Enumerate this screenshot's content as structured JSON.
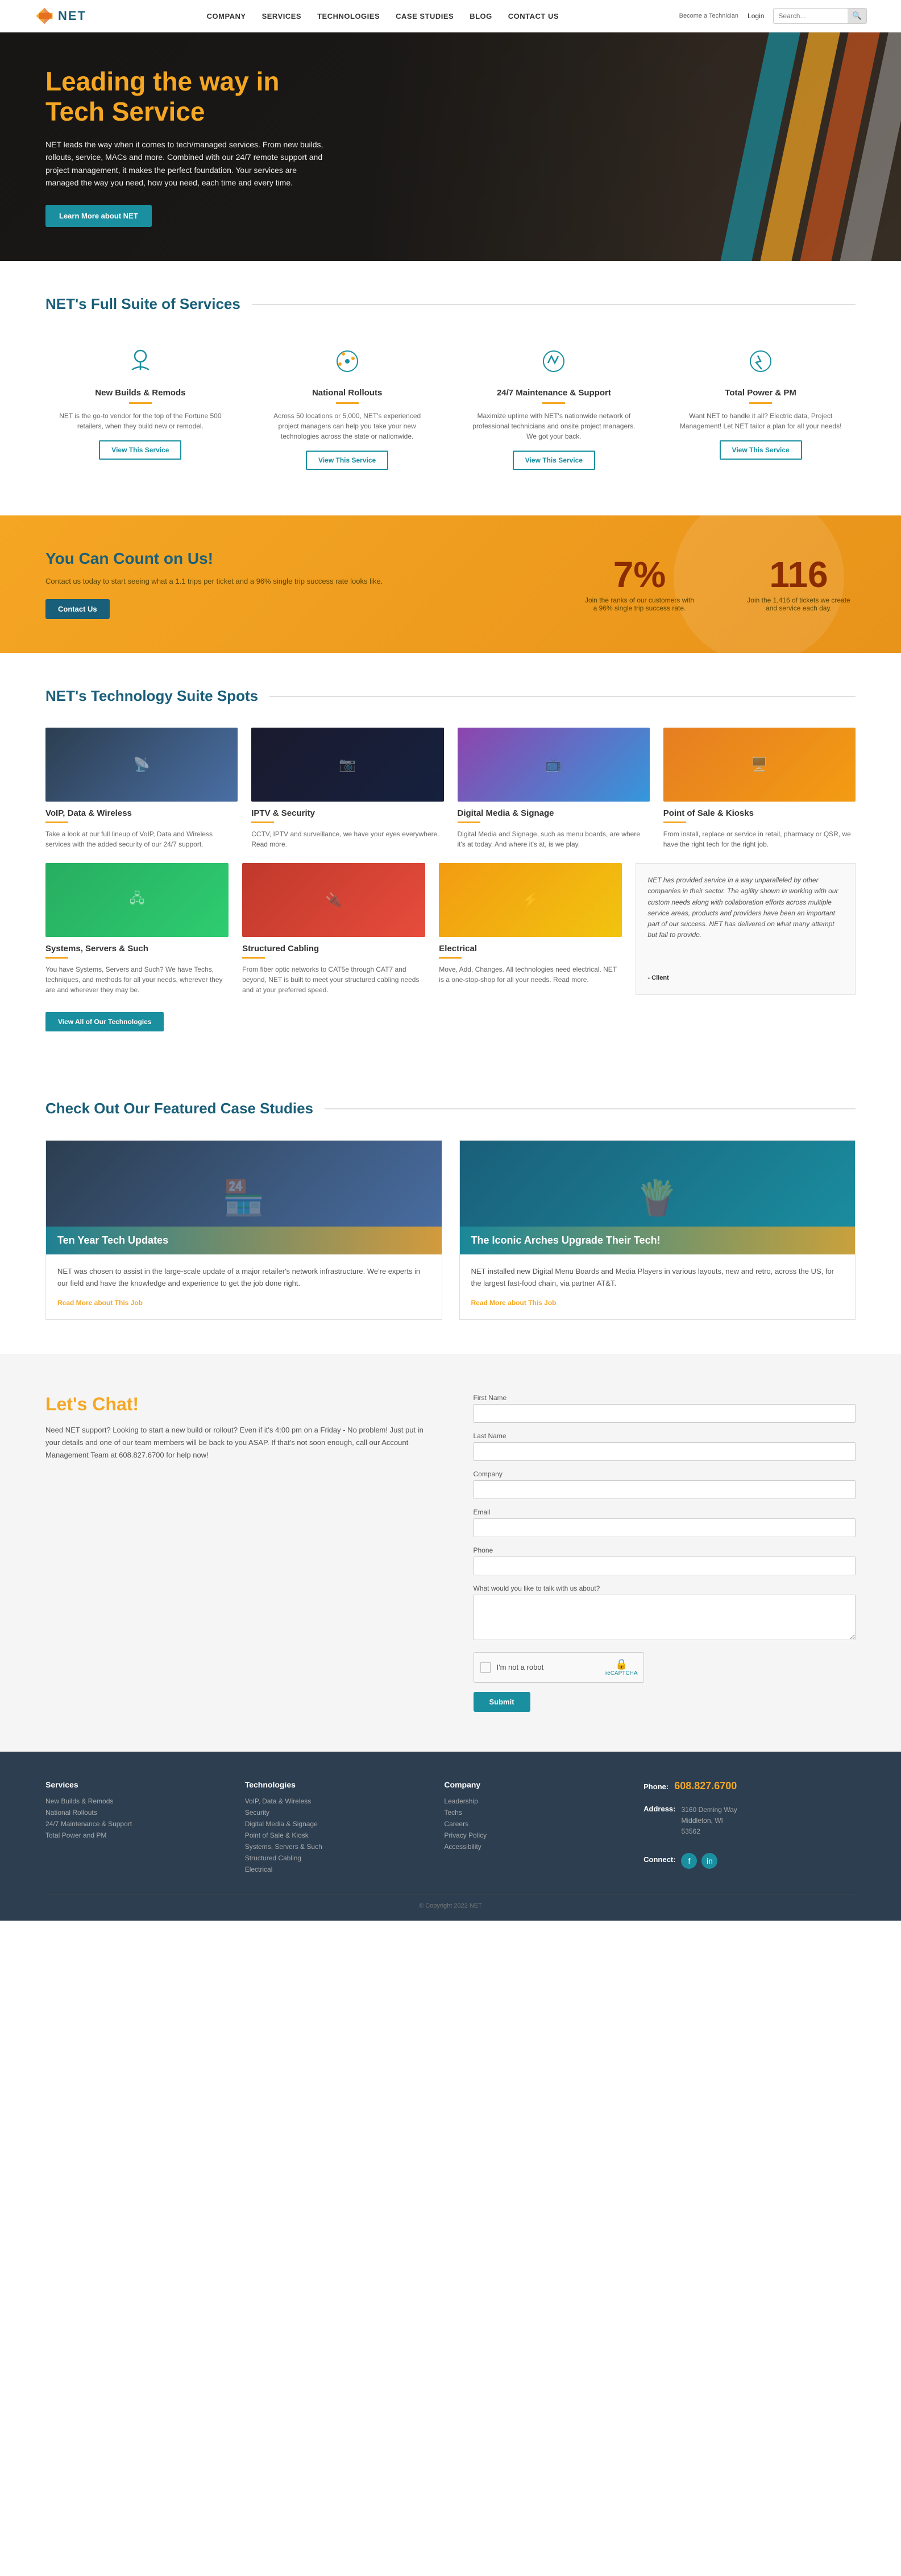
{
  "site": {
    "logo_text": "NET",
    "tagline": "Leading the way in Tech Service"
  },
  "nav": {
    "items": [
      {
        "label": "COMPANY",
        "href": "#"
      },
      {
        "label": "SERVICES",
        "href": "#"
      },
      {
        "label": "TECHNOLOGIES",
        "href": "#"
      },
      {
        "label": "CASE STUDIES",
        "href": "#"
      },
      {
        "label": "BLOG",
        "href": "#"
      },
      {
        "label": "CONTACT US",
        "href": "#"
      }
    ]
  },
  "header": {
    "become_tech": "Become a Technician",
    "login": "Login",
    "search_placeholder": "Search..."
  },
  "hero": {
    "title": "Leading the way in Tech Service",
    "description": "NET leads the way when it comes to tech/managed services. From new builds, rollouts, service, MACs and more. Combined with our 24/7 remote support and project management, it makes the perfect foundation. Your services are managed the way you need, how you need, each time and every time.",
    "cta_label": "Learn More about NET"
  },
  "services_section": {
    "heading": "NET's Full Suite of Services",
    "services": [
      {
        "icon": "🔧",
        "name": "New Builds & Remods",
        "description": "NET is the go-to vendor for the top of the Fortune 500 retailers, when they build new or remodel.",
        "btn_label": "View This Service"
      },
      {
        "icon": "🗺️",
        "name": "National Rollouts",
        "description": "Across 50 locations or 5,000, NET's experienced project managers can help you take your new technologies across the state or nationwide.",
        "btn_label": "View This Service"
      },
      {
        "icon": "🔨",
        "name": "24/7 Maintenance & Support",
        "description": "Maximize uptime with NET's nationwide network of professional technicians and onsite project managers. We got your back.",
        "btn_label": "View This Service"
      },
      {
        "icon": "⚡",
        "name": "Total Power & PM",
        "description": "Want NET to handle it all? Electric data, Project Management! Let NET tailor a plan for all your needs!",
        "btn_label": "View This Service"
      }
    ]
  },
  "count_section": {
    "title": "You Can Count on Us!",
    "description": "Contact us today to start seeing what a 1.1 trips per ticket and a 96% single trip success rate looks like.",
    "btn_label": "Contact Us",
    "stat1_number": "7%",
    "stat1_label": "Join the ranks of our customers with a 96% single trip success rate.",
    "stat2_number": "116",
    "stat2_label": "Join the 1,416 of tickets we create and service each day."
  },
  "tech_section": {
    "heading": "NET's Technology Suite Spots",
    "technologies": [
      {
        "name": "VoIP, Data & Wireless",
        "description": "Take a look at our full lineup of VoIP, Data and Wireless services with the added security of our 24/7 support.",
        "color_class": "img-voip"
      },
      {
        "name": "IPTV & Security",
        "description": "CCTV, IPTV and surveillance, we have your eyes everywhere. Read more.",
        "color_class": "img-iptv"
      },
      {
        "name": "Digital Media & Signage",
        "description": "Digital Media and Signage, such as menu boards, are where it's at today. And where it's at, is we play.",
        "color_class": "img-digital"
      },
      {
        "name": "Point of Sale & Kiosks",
        "description": "From install, replace or service in retail, pharmacy or QSR, we have the right tech for the right job.",
        "color_class": "img-pos"
      }
    ],
    "technologies_lower": [
      {
        "name": "Systems, Servers & Such",
        "description": "You have Systems, Servers and Such? We have Techs, techniques, and methods for all your needs, wherever they are and wherever they may be.",
        "color_class": "img-servers"
      },
      {
        "name": "Structured Cabling",
        "description": "From fiber optic networks to CAT5e through CAT7 and beyond, NET is built to meet your structured cabling needs and at your preferred speed.",
        "color_class": "img-cabling"
      },
      {
        "name": "Electrical",
        "description": "Move, Add, Changes. All technologies need electrical. NET is a one-stop-shop for all your needs. Read more.",
        "color_class": "img-electrical"
      }
    ],
    "testimonial": {
      "text": "NET has provided service in a way unparalleled by other companies in their sector. The agility shown in working with our custom needs along with collaboration efforts across multiple service areas, products and providers have been an important part of our success. NET has delivered on what many attempt but fail to provide.",
      "author": "- Client"
    },
    "view_all_label": "View All of Our Technologies"
  },
  "case_studies": {
    "heading": "Check Out Our Featured Case Studies",
    "studies": [
      {
        "title": "Ten Year Tech Updates",
        "description": "NET was chosen to assist in the large-scale update of a major retailer's network infrastructure. We're experts in our field and have the knowledge and experience to get the job done right.",
        "link_label": "Read More about This Job",
        "color_class": "img-case1"
      },
      {
        "title": "The Iconic Arches Upgrade Their Tech!",
        "description": "NET installed new Digital Menu Boards and Media Players in various layouts, new and retro, across the US, for the largest fast-food chain, via partner AT&T.",
        "link_label": "Read More about This Job",
        "color_class": "img-case2"
      }
    ]
  },
  "contact_section": {
    "title": "Let's Chat!",
    "description": "Need NET support? Looking to start a new build or rollout? Even if it's 4:00 pm on a Friday - No problem! Just put in your details and one of our team members will be back to you ASAP. If that's not soon enough, call our Account Management Team at 608.827.6700 for help now!",
    "form": {
      "first_name_label": "First Name",
      "last_name_label": "Last Name",
      "company_label": "Company",
      "email_label": "Email",
      "phone_label": "Phone",
      "message_label": "What would you like to talk with us about?",
      "captcha_text": "I'm not a robot",
      "submit_label": "Submit"
    }
  },
  "footer": {
    "copyright": "© Copyright 2022 NET",
    "services": {
      "title": "Services",
      "links": [
        "New Builds & Remods",
        "National Rollouts",
        "24/7 Maintenance & Support",
        "Total Power and PM"
      ]
    },
    "technologies": {
      "title": "Technologies",
      "links": [
        "VoIP, Data & Wireless",
        "Security",
        "Digital Media & Signage",
        "Point of Sale & Kiosk",
        "Systems, Servers & Such",
        "Structured Cabling",
        "Electrical"
      ]
    },
    "company": {
      "title": "Company",
      "links": [
        "Leadership",
        "Techs",
        "Careers",
        "Privacy Policy",
        "Accessibility"
      ]
    },
    "contact": {
      "phone_label": "Phone:",
      "phone": "608.827.6700",
      "address_label": "Address:",
      "address": "3160 Deming Way\nMiddleton, WI\n53562",
      "connect_label": "Connect:"
    }
  }
}
